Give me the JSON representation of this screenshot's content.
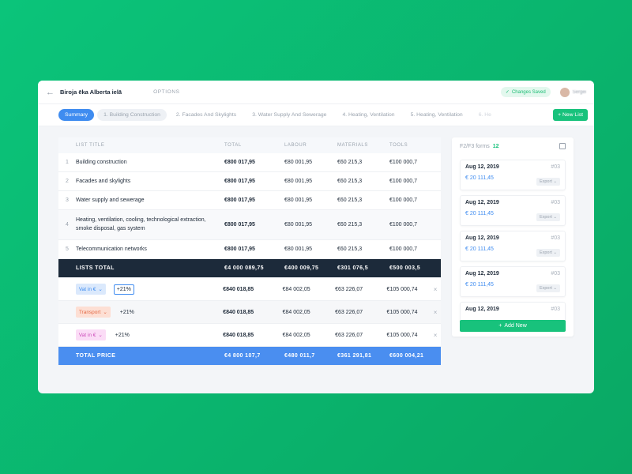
{
  "header": {
    "back_icon": "arrow-left-icon",
    "title": "Biroja ēka Alberta ielā",
    "options": "OPTIONS",
    "status": "Changes Saved",
    "user": "Sergei"
  },
  "tabs": [
    {
      "label": "Summary"
    },
    {
      "label": "1. Building Construction"
    },
    {
      "label": "2. Facades And Skylights"
    },
    {
      "label": "3. Water Supply And Sewerage"
    },
    {
      "label": "4. Heating, Ventilation"
    },
    {
      "label": "5. Heating, Ventilation"
    },
    {
      "label": "6. He"
    }
  ],
  "new_list_label": "New List",
  "table": {
    "columns": [
      "LIST TITLE",
      "TOTAL",
      "LABOUR",
      "MATERIALS",
      "TOOLS"
    ],
    "rows": [
      {
        "num": "1",
        "title": "Building construction",
        "total": "€800 017,95",
        "labour": "€80 001,95",
        "materials": "€60 215,3",
        "tools": "€100 000,7"
      },
      {
        "num": "2",
        "title": "Facades and skylights",
        "total": "€800 017,95",
        "labour": "€80 001,95",
        "materials": "€60 215,3",
        "tools": "€100 000,7"
      },
      {
        "num": "3",
        "title": "Water supply and sewerage",
        "total": "€800 017,95",
        "labour": "€80 001,95",
        "materials": "€60 215,3",
        "tools": "€100 000,7"
      },
      {
        "num": "4",
        "title": "Heating, ventilation, cooling, technological extraction, smoke disposal, gas system",
        "total": "€800 017,95",
        "labour": "€80 001,95",
        "materials": "€60 215,3",
        "tools": "€100 000,7"
      },
      {
        "num": "5",
        "title": "Telecommunication networks",
        "total": "€800 017,95",
        "labour": "€80 001,95",
        "materials": "€60 215,3",
        "tools": "€100 000,7"
      }
    ],
    "lists_total": {
      "label": "LISTS TOTAL",
      "total": "€4 000 089,75",
      "labour": "€400 009,75",
      "materials": "€301 076,5",
      "tools": "€500 003,5"
    },
    "adjustments": [
      {
        "tag": "Vat in €",
        "pct": "+21%",
        "total": "€840 018,85",
        "labour": "€84 002,05",
        "materials": "€63 226,07",
        "tools": "€105 000,74"
      },
      {
        "tag": "Transport",
        "pct": "+21%",
        "total": "€840 018,85",
        "labour": "€84 002,05",
        "materials": "€63 226,07",
        "tools": "€105 000,74"
      },
      {
        "tag": "Vat in €",
        "pct": "+21%",
        "total": "€840 018,85",
        "labour": "€84 002,05",
        "materials": "€63 226,07",
        "tools": "€105 000,74"
      }
    ],
    "total_price": {
      "label": "TOTAL PRICE",
      "total": "€4 800 107,7",
      "labour": "€480 011,7",
      "materials": "€361 291,81",
      "tools": "€600 004,21"
    }
  },
  "side": {
    "title": "F2/F3 forms",
    "count": "12",
    "cards": [
      {
        "date": "Aug 12, 2019",
        "no": "#03",
        "amount": "€ 20 111,45",
        "export": "Export"
      },
      {
        "date": "Aug 12, 2019",
        "no": "#03",
        "amount": "€ 20 111,45",
        "export": "Export"
      },
      {
        "date": "Aug 12, 2019",
        "no": "#03",
        "amount": "€ 20 111,45",
        "export": "Export"
      },
      {
        "date": "Aug 12, 2019",
        "no": "#03",
        "amount": "€ 20 111,45",
        "export": "Export"
      },
      {
        "date": "Aug 12, 2019",
        "no": "#03",
        "amount": "",
        "export": ""
      }
    ],
    "add_new": "Add New"
  },
  "colors": {
    "accent": "#3f8cf0",
    "green": "#18c27c",
    "dark": "#1c2a3a"
  }
}
